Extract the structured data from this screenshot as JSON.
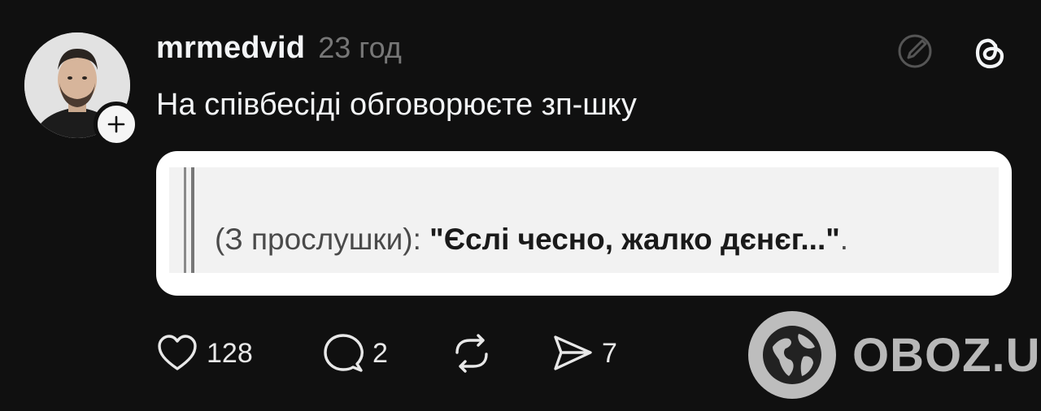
{
  "post": {
    "username": "mrmedvid",
    "time": "23 год",
    "text": "На співбесіді обговорюєте зп-шку",
    "quote": {
      "prefix": "(З прослушки): ",
      "emphasis": "\"Єслі чесно, жалко дєнєг...\"",
      "suffix": "."
    }
  },
  "actions": {
    "likes": "128",
    "comments": "2",
    "shares": "7"
  },
  "watermark": {
    "text": "OBOZ.UA"
  }
}
